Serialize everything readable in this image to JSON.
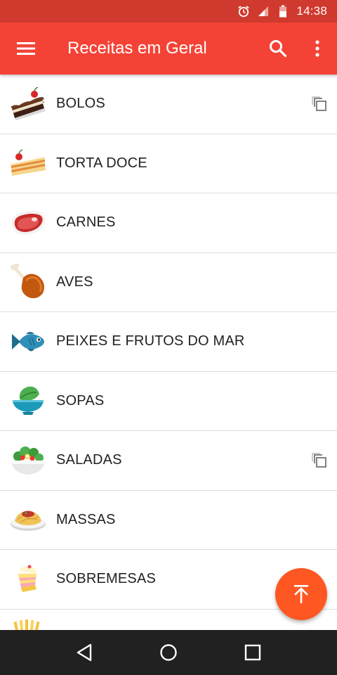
{
  "status_bar": {
    "time": "14:38",
    "icons": [
      "alarm-icon",
      "signal-icon",
      "battery-icon"
    ]
  },
  "app_bar": {
    "title": "Receitas em Geral",
    "icons": [
      "menu-icon",
      "search-icon",
      "more-vert-icon"
    ],
    "background_color": "#f44336"
  },
  "categories": [
    {
      "label": "BOLOS",
      "icon": "cake-icon",
      "has_copy": true
    },
    {
      "label": "TORTA DOCE",
      "icon": "torte-icon",
      "has_copy": false
    },
    {
      "label": "CARNES",
      "icon": "meat-icon",
      "has_copy": false
    },
    {
      "label": "AVES",
      "icon": "poultry-leg-icon",
      "has_copy": false
    },
    {
      "label": "PEIXES E FRUTOS DO MAR",
      "icon": "fish-icon",
      "has_copy": false
    },
    {
      "label": "SOPAS",
      "icon": "soup-icon",
      "has_copy": false
    },
    {
      "label": "SALADAS",
      "icon": "salad-icon",
      "has_copy": true
    },
    {
      "label": "MASSAS",
      "icon": "pasta-icon",
      "has_copy": false
    },
    {
      "label": "SOBREMESAS",
      "icon": "dessert-icon",
      "has_copy": false
    },
    {
      "label": "",
      "icon": "fries-icon",
      "has_copy": false
    }
  ],
  "fab": {
    "icon": "scroll-to-top-icon",
    "color": "#ff5722"
  },
  "nav_bar": {
    "icons": [
      "back-icon",
      "home-icon",
      "recents-icon"
    ]
  }
}
